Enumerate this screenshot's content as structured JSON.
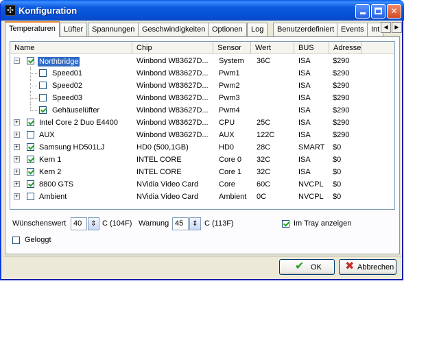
{
  "window": {
    "title": "Konfiguration"
  },
  "tabs": [
    {
      "label": "Temperaturen",
      "active": true
    },
    {
      "label": "Lüfter"
    },
    {
      "label": "Spannungen"
    },
    {
      "label": "Geschwindigkeiten"
    },
    {
      "label": "Optionen"
    },
    {
      "label": "Log"
    },
    {
      "label": "Benutzerdefiniert"
    },
    {
      "label": "Events"
    },
    {
      "label": "Int"
    }
  ],
  "table": {
    "columns": [
      "Name",
      "Chip",
      "Sensor",
      "Wert",
      "BUS",
      "Adresse"
    ],
    "rows": [
      {
        "name": "Northbridge",
        "chip": "Winbond W83627D...",
        "sensor": "System",
        "wert": "36C",
        "bus": "ISA",
        "adresse": "$290",
        "checked": true,
        "level": 0,
        "expander": "-",
        "selected": true
      },
      {
        "name": "Speed01",
        "chip": "Winbond W83627D...",
        "sensor": "Pwm1",
        "wert": "",
        "bus": "ISA",
        "adresse": "$290",
        "checked": false,
        "level": 1
      },
      {
        "name": "Speed02",
        "chip": "Winbond W83627D...",
        "sensor": "Pwm2",
        "wert": "",
        "bus": "ISA",
        "adresse": "$290",
        "checked": false,
        "level": 1
      },
      {
        "name": "Speed03",
        "chip": "Winbond W83627D...",
        "sensor": "Pwm3",
        "wert": "",
        "bus": "ISA",
        "adresse": "$290",
        "checked": false,
        "level": 1
      },
      {
        "name": "Gehäuselüfter",
        "chip": "Winbond W83627D...",
        "sensor": "Pwm4",
        "wert": "",
        "bus": "ISA",
        "adresse": "$290",
        "checked": true,
        "level": 1
      },
      {
        "name": "Intel Core 2 Duo E4400",
        "chip": "Winbond W83627D...",
        "sensor": "CPU",
        "wert": "25C",
        "bus": "ISA",
        "adresse": "$290",
        "checked": true,
        "level": 0,
        "expander": "+"
      },
      {
        "name": "AUX",
        "chip": "Winbond W83627D...",
        "sensor": "AUX",
        "wert": "122C",
        "bus": "ISA",
        "adresse": "$290",
        "checked": false,
        "level": 0,
        "expander": "+"
      },
      {
        "name": "Samsung HD501LJ",
        "chip": "HD0 (500,1GB)",
        "sensor": "HD0",
        "wert": "28C",
        "bus": "SMART",
        "adresse": "$0",
        "checked": true,
        "level": 0,
        "expander": "+"
      },
      {
        "name": "Kern 1",
        "chip": "INTEL CORE",
        "sensor": "Core 0",
        "wert": "32C",
        "bus": "ISA",
        "adresse": "$0",
        "checked": true,
        "level": 0,
        "expander": "+"
      },
      {
        "name": "Kern 2",
        "chip": "INTEL CORE",
        "sensor": "Core 1",
        "wert": "32C",
        "bus": "ISA",
        "adresse": "$0",
        "checked": true,
        "level": 0,
        "expander": "+"
      },
      {
        "name": "8800 GTS",
        "chip": "NVidia Video Card",
        "sensor": "Core",
        "wert": "60C",
        "bus": "NVCPL",
        "adresse": "$0",
        "checked": true,
        "level": 0,
        "expander": "+"
      },
      {
        "name": "Ambient",
        "chip": "NVidia Video Card",
        "sensor": "Ambient",
        "wert": "0C",
        "bus": "NVCPL",
        "adresse": "$0",
        "checked": false,
        "level": 0,
        "expander": "+"
      }
    ]
  },
  "settings": {
    "wunschwert_label": "Wünschenswert",
    "wunschwert_value": "40",
    "wunschwert_unit": "C (104F)",
    "warnung_label": "Warnung",
    "warnung_value": "45",
    "warnung_unit": "C (113F)",
    "tray_label": "Im Tray anzeigen",
    "tray_checked": true,
    "geloggt_label": "Geloggt",
    "geloggt_checked": false
  },
  "buttons": {
    "ok": "OK",
    "cancel": "Abbrechen"
  }
}
